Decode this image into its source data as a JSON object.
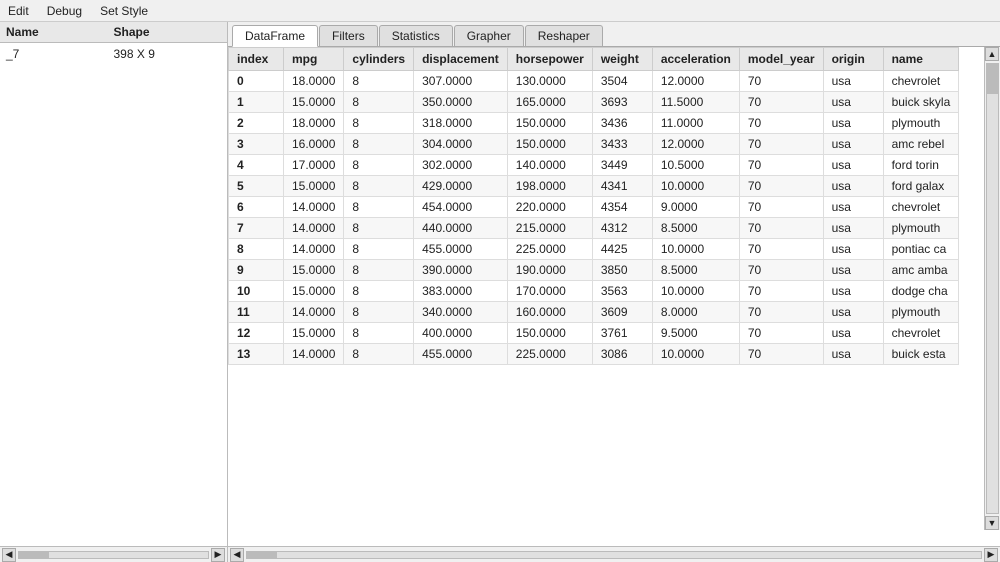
{
  "menu": {
    "items": [
      "Edit",
      "Debug",
      "Set Style"
    ]
  },
  "left_panel": {
    "headers": [
      "Name",
      "Shape"
    ],
    "rows": [
      {
        "name": "_7",
        "shape": "398 X 9"
      }
    ]
  },
  "tabs": [
    {
      "label": "DataFrame",
      "active": true
    },
    {
      "label": "Filters",
      "active": false
    },
    {
      "label": "Statistics",
      "active": false
    },
    {
      "label": "Grapher",
      "active": false
    },
    {
      "label": "Reshaper",
      "active": false
    }
  ],
  "table": {
    "columns": [
      "index",
      "mpg",
      "cylinders",
      "displacement",
      "horsepower",
      "weight",
      "acceleration",
      "model_year",
      "origin",
      "name"
    ],
    "rows": [
      [
        0,
        "18.0000",
        8,
        "307.0000",
        "130.0000",
        3504,
        "12.0000",
        70,
        "usa",
        "chevrolet"
      ],
      [
        1,
        "15.0000",
        8,
        "350.0000",
        "165.0000",
        3693,
        "11.5000",
        70,
        "usa",
        "buick skyla"
      ],
      [
        2,
        "18.0000",
        8,
        "318.0000",
        "150.0000",
        3436,
        "11.0000",
        70,
        "usa",
        "plymouth"
      ],
      [
        3,
        "16.0000",
        8,
        "304.0000",
        "150.0000",
        3433,
        "12.0000",
        70,
        "usa",
        "amc rebel"
      ],
      [
        4,
        "17.0000",
        8,
        "302.0000",
        "140.0000",
        3449,
        "10.5000",
        70,
        "usa",
        "ford torin"
      ],
      [
        5,
        "15.0000",
        8,
        "429.0000",
        "198.0000",
        4341,
        "10.0000",
        70,
        "usa",
        "ford galax"
      ],
      [
        6,
        "14.0000",
        8,
        "454.0000",
        "220.0000",
        4354,
        "9.0000",
        70,
        "usa",
        "chevrolet"
      ],
      [
        7,
        "14.0000",
        8,
        "440.0000",
        "215.0000",
        4312,
        "8.5000",
        70,
        "usa",
        "plymouth"
      ],
      [
        8,
        "14.0000",
        8,
        "455.0000",
        "225.0000",
        4425,
        "10.0000",
        70,
        "usa",
        "pontiac ca"
      ],
      [
        9,
        "15.0000",
        8,
        "390.0000",
        "190.0000",
        3850,
        "8.5000",
        70,
        "usa",
        "amc amba"
      ],
      [
        10,
        "15.0000",
        8,
        "383.0000",
        "170.0000",
        3563,
        "10.0000",
        70,
        "usa",
        "dodge cha"
      ],
      [
        11,
        "14.0000",
        8,
        "340.0000",
        "160.0000",
        3609,
        "8.0000",
        70,
        "usa",
        "plymouth"
      ],
      [
        12,
        "15.0000",
        8,
        "400.0000",
        "150.0000",
        3761,
        "9.5000",
        70,
        "usa",
        "chevrolet"
      ],
      [
        13,
        "14.0000",
        8,
        "455.0000",
        "225.0000",
        3086,
        "10.0000",
        70,
        "usa",
        "buick esta"
      ]
    ]
  }
}
